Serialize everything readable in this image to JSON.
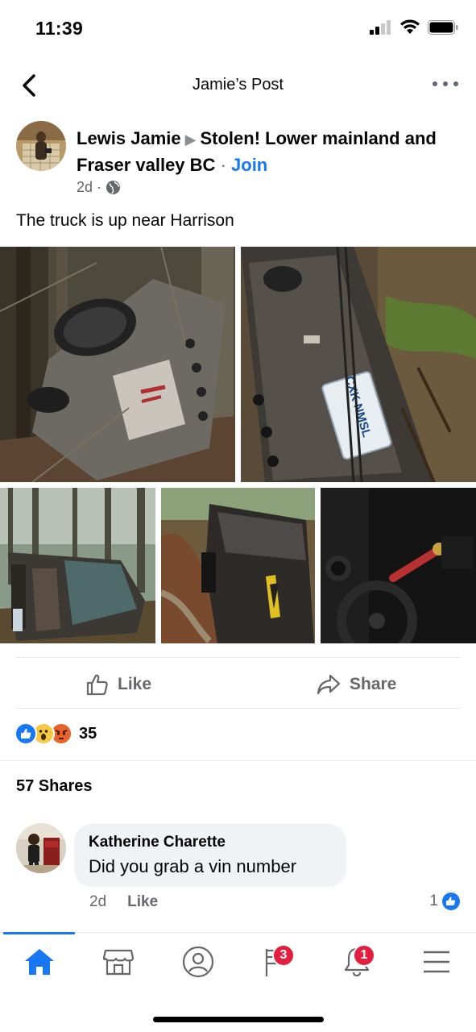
{
  "status_bar": {
    "time": "11:39"
  },
  "nav": {
    "title": "Jamie’s Post"
  },
  "post": {
    "author": "Lewis Jamie",
    "group": "Stolen! Lower mainland and Fraser valley BC",
    "separator": "·",
    "join_label": "Join",
    "time": "2d",
    "meta_separator": "·",
    "privacy_icon": "globe-icon",
    "text": "The truck is up near Harrison",
    "photos": [
      {
        "name": "photo-truck-underside",
        "plate_text": ""
      },
      {
        "name": "photo-license-plate",
        "plate_text": "CXK NMSL"
      },
      {
        "name": "photo-truck-side-forest"
      },
      {
        "name": "photo-truck-rear-hatch"
      },
      {
        "name": "photo-truck-interior-shifter"
      }
    ]
  },
  "actions": {
    "like_label": "Like",
    "share_label": "Share"
  },
  "reactions": {
    "types": [
      "like",
      "wow",
      "angry"
    ],
    "count": "35"
  },
  "shares": {
    "label": "57 Shares"
  },
  "comment": {
    "author": "Katherine Charette",
    "text": "Did you grab a vin number",
    "time": "2d",
    "like_label": "Like",
    "reaction_count": "1"
  },
  "tab_bar": {
    "tabs": [
      {
        "name": "home",
        "badge": ""
      },
      {
        "name": "marketplace",
        "badge": ""
      },
      {
        "name": "profile",
        "badge": ""
      },
      {
        "name": "pages",
        "badge": "3"
      },
      {
        "name": "notifications",
        "badge": "1"
      },
      {
        "name": "menu",
        "badge": ""
      }
    ]
  },
  "colors": {
    "accent": "#1877f2",
    "badge": "#e41e3f",
    "secondary_text": "#65676b"
  }
}
